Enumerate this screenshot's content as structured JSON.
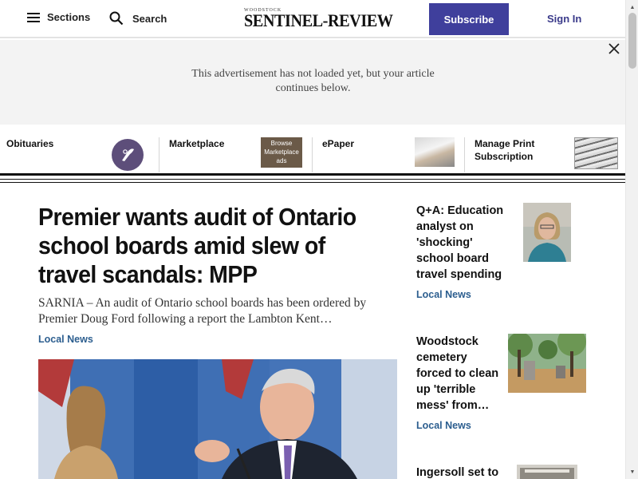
{
  "header": {
    "sections_label": "Sections",
    "search_label": "Search",
    "logo_small": "WOODSTOCK",
    "logo_main": "SENTINEL-REVIEW",
    "subscribe_label": "Subscribe",
    "signin_label": "Sign In",
    "accent_color": "#3f3f9c"
  },
  "ad": {
    "message": "This advertisement has not loaded yet, but your article continues below."
  },
  "quick_links": [
    {
      "label": "Obituaries",
      "icon": "obituary-quill-icon"
    },
    {
      "label": "Marketplace",
      "thumb_text": "Browse Marketplace ads"
    },
    {
      "label": "ePaper"
    },
    {
      "label": "Manage Print Subscription"
    }
  ],
  "main_story": {
    "headline": "Premier wants audit of Ontario school boards amid slew of travel scandals: MPP",
    "summary": "SARNIA – An audit of Ontario school boards has been ordered by Premier Doug Ford following a report the Lambton Kent…",
    "category": "Local News"
  },
  "side_stories": [
    {
      "headline": "Q+A: Education analyst on 'shocking' school board travel spending",
      "category": "Local News"
    },
    {
      "headline": "Woodstock cemetery forced to clean up 'terrible mess' from…",
      "category": "Local News"
    },
    {
      "headline": "Ingersoll set to",
      "category": ""
    }
  ]
}
